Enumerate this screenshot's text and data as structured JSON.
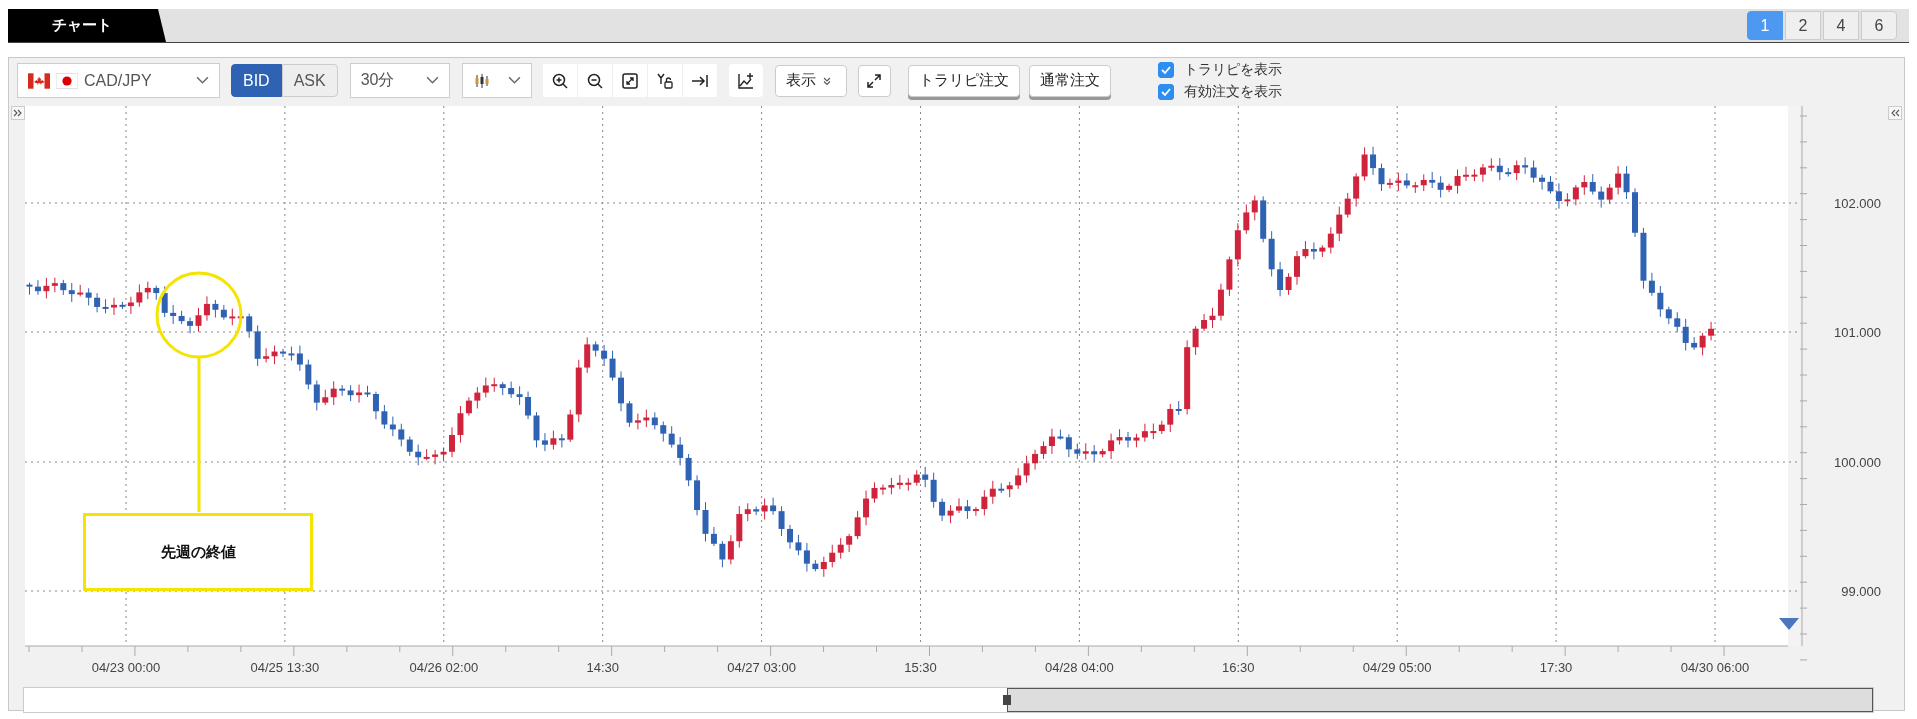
{
  "tab": {
    "title": "チャート"
  },
  "layout_buttons": [
    {
      "label": "1",
      "selected": true
    },
    {
      "label": "2",
      "selected": false
    },
    {
      "label": "4",
      "selected": false
    },
    {
      "label": "6",
      "selected": false
    }
  ],
  "toolbar": {
    "symbol": "CAD/JPY",
    "price_side": [
      {
        "label": "BID",
        "selected": true
      },
      {
        "label": "ASK",
        "selected": false
      }
    ],
    "timeframe": "30分",
    "display_menu": "表示",
    "order_buttons": [
      "トラリピ注文",
      "通常注文"
    ],
    "options": [
      {
        "label": "トラリピを表示",
        "checked": true
      },
      {
        "label": "有効注文を表示",
        "checked": true
      }
    ]
  },
  "chart": {
    "y_labels": [
      "102.000",
      "101.000",
      "100.000",
      "99.000"
    ],
    "x_labels": [
      "04/23 00:00",
      "04/25 13:30",
      "04/26 02:00",
      "14:30",
      "04/27 03:00",
      "15:30",
      "04/28 04:00",
      "16:30",
      "04/29 05:00",
      "17:30",
      "04/30 06:00"
    ],
    "annotation": "先週の終値"
  }
}
